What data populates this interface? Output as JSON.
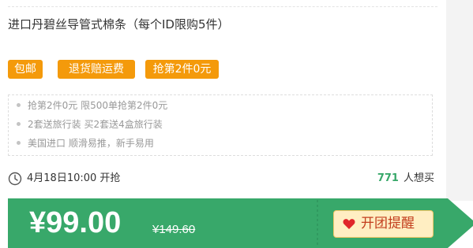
{
  "product": {
    "title": "进口丹碧丝导管式棉条（每个ID限购5件）"
  },
  "badges": [
    {
      "label": "包邮"
    },
    {
      "label": "退货赔运费"
    },
    {
      "label": "抢第2件0元"
    }
  ],
  "features": [
    {
      "text": "抢第2件0元 限500单抢第2件0元"
    },
    {
      "text": "2套送旅行装 买2套送4盒旅行装"
    },
    {
      "text": "美国进口 顺滑易推，新手易用"
    }
  ],
  "meta": {
    "start_time": "4月18日10:00 开抢",
    "want_count": "771",
    "want_label": "人想买"
  },
  "price": {
    "current": "¥99.00",
    "original": "¥149.60"
  },
  "remind_button": {
    "label": "开团提醒"
  },
  "colors": {
    "badge": "#f49a0b",
    "price_bar": "#38a86a",
    "want_count": "#38a86a",
    "remind_bg": "#ffeec2",
    "remind_text": "#c33f1e",
    "heart": "#e0252a"
  },
  "icons": {
    "clock": "clock-icon",
    "heart": "heart-icon"
  }
}
